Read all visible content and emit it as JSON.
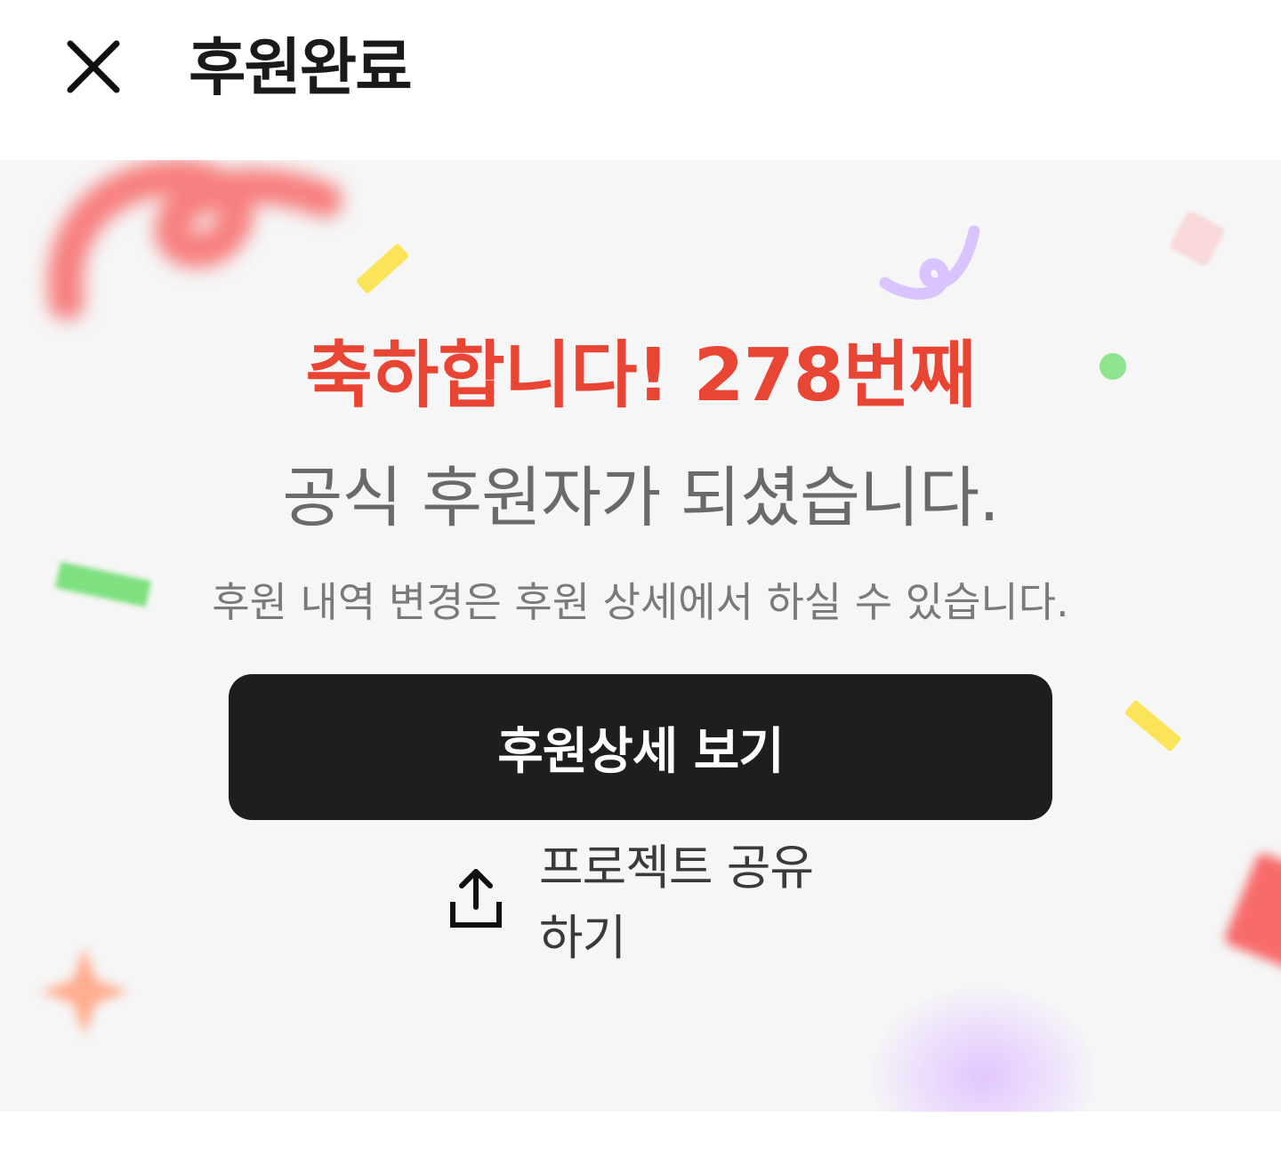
{
  "header": {
    "title": "후원완료",
    "close_icon": "close-icon"
  },
  "celebration": {
    "congrats_text": "축하합니다! 278번째",
    "supporter_number": 278,
    "subtitle": "공식 후원자가 되셨습니다.",
    "note": "후원 내역 변경은 후원 상세에서 하실 수 있습니다."
  },
  "actions": {
    "detail_button_label": "후원상세 보기",
    "share_label": "프로젝트 공유하기",
    "share_icon": "share-upload-icon"
  },
  "colors": {
    "accent_red": "#e84535",
    "button_dark": "#1e1e1e",
    "panel_bg": "#f6f6f6"
  }
}
